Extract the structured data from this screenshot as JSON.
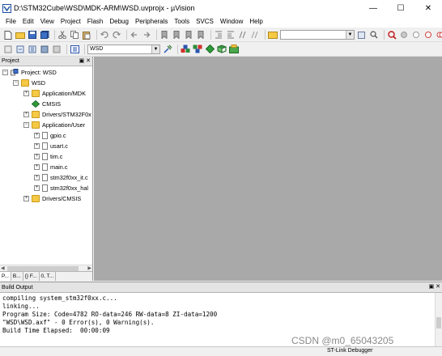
{
  "window": {
    "title": "D:\\STM32Cube\\WSD\\MDK-ARM\\WSD.uvprojx - µVision",
    "minimize_glyph": "—",
    "maximize_glyph": "☐",
    "close_glyph": "✕"
  },
  "menu": [
    "File",
    "Edit",
    "View",
    "Project",
    "Flash",
    "Debug",
    "Peripherals",
    "Tools",
    "SVCS",
    "Window",
    "Help"
  ],
  "toolbar2": {
    "target": "WSD"
  },
  "project_panel": {
    "title": "Project",
    "header_buttons": "▣ ✕",
    "tree": [
      {
        "label": "Project: WSD",
        "level": 0,
        "expander": "−",
        "icon": "project-icon"
      },
      {
        "label": "WSD",
        "level": 1,
        "expander": "−",
        "icon": "folder-icon"
      },
      {
        "label": "Application/MDK",
        "level": 2,
        "expander": "+",
        "icon": "folder-icon"
      },
      {
        "label": "CMSIS",
        "level": 2,
        "expander": "",
        "icon": "green-diamond-icon"
      },
      {
        "label": "Drivers/STM32F0x",
        "level": 2,
        "expander": "+",
        "icon": "folder-icon"
      },
      {
        "label": "Application/User",
        "level": 2,
        "expander": "−",
        "icon": "folder-icon"
      },
      {
        "label": "gpio.c",
        "level": 3,
        "expander": "+",
        "icon": "file-icon"
      },
      {
        "label": "usart.c",
        "level": 3,
        "expander": "+",
        "icon": "file-icon"
      },
      {
        "label": "tim.c",
        "level": 3,
        "expander": "+",
        "icon": "file-icon"
      },
      {
        "label": "main.c",
        "level": 3,
        "expander": "+",
        "icon": "file-icon"
      },
      {
        "label": "stm32f0xx_it.c",
        "level": 3,
        "expander": "+",
        "icon": "file-icon"
      },
      {
        "label": "stm32f0xx_hal",
        "level": 3,
        "expander": "+",
        "icon": "file-icon"
      },
      {
        "label": "Drivers/CMSIS",
        "level": 2,
        "expander": "+",
        "icon": "folder-icon"
      }
    ],
    "tabs": [
      "P...",
      "B...",
      "{} F...",
      "0, T..."
    ]
  },
  "build_output": {
    "title": "Build Output",
    "header_buttons": "▣ ✕",
    "lines": [
      "compiling system_stm32f0xx.c...",
      "linking...",
      "Program Size: Code=4782 RO-data=246 RW-data=8 ZI-data=1200",
      "\"WSD\\WSD.axf\" - 0 Error(s), 0 Warning(s).",
      "Build Time Elapsed:  00:00:09"
    ]
  },
  "status": {
    "debugger": "ST-Link Debugger"
  },
  "watermark": "CSDN @m0_65043205",
  "colors": {
    "editor_bg": "#a9a9a9",
    "folder": "#f6c945",
    "panel_header": "#e4e4e4"
  }
}
